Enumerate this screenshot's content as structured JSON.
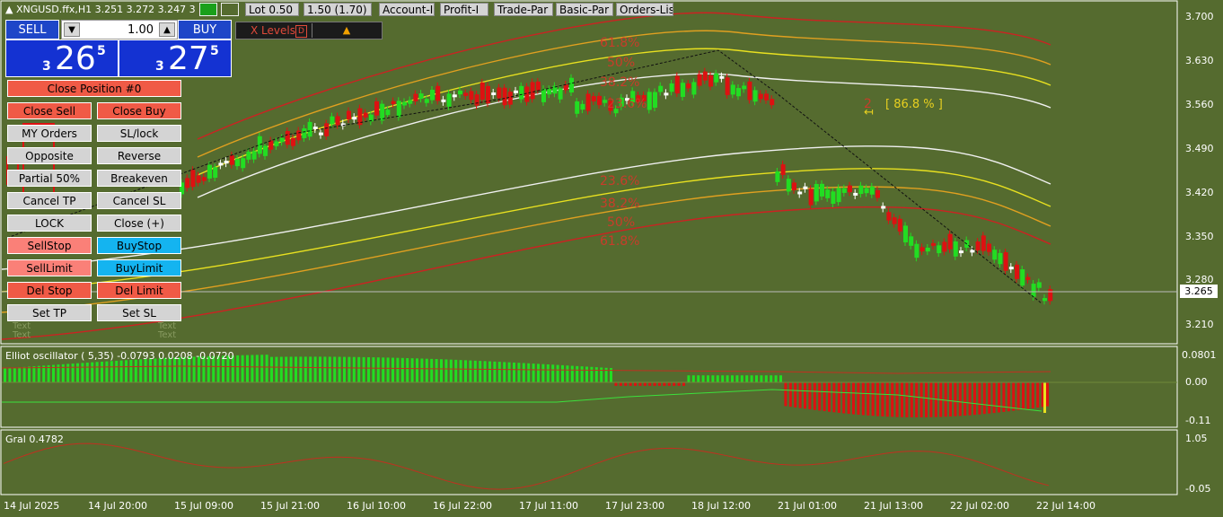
{
  "header": {
    "symbol_info": "XNGUSD.ffx,H1  3.251 3.272 3.247 3",
    "buttons": [
      "Lot 0.50",
      "1.50 (1.70)",
      "Account-I",
      "Profit-I",
      "Trade-Par",
      "Basic-Par",
      "Orders-List"
    ]
  },
  "trade_panel": {
    "sell_label": "SELL",
    "buy_label": "BUY",
    "lot_value": "1.00",
    "sell_price": {
      "prefix": "3",
      "big": "26",
      "sup": "5"
    },
    "buy_price": {
      "prefix": "3",
      "big": "27",
      "sup": "5"
    }
  },
  "xlevels": {
    "label": "X Levels",
    "box": "D"
  },
  "actions": {
    "close_position": "Close Position #0",
    "rows": [
      [
        "Close Sell",
        "Close Buy"
      ],
      [
        "MY Orders",
        "SL/lock"
      ],
      [
        "Opposite",
        "Reverse"
      ],
      [
        "Partial 50%",
        "Breakeven"
      ],
      [
        "Cancel TP",
        "Cancel SL"
      ],
      [
        "LOCK",
        "Close (+)"
      ],
      [
        "SellStop",
        "BuyStop"
      ],
      [
        "SellLimit",
        "BuyLimit"
      ],
      [
        "Del Stop",
        "Del Limit"
      ],
      [
        "Set TP",
        "Set SL"
      ]
    ],
    "text_placeholder": "Text"
  },
  "fib_labels": {
    "upper": [
      "61.8%",
      "50%",
      "38.2%",
      "23.6%"
    ],
    "lower": [
      "23.6%",
      "38.2%",
      "50%",
      "61.8%"
    ]
  },
  "annotation": {
    "wave": "2",
    "pct": "[ 86.8 % ]"
  },
  "price_axis": {
    "labels": [
      "3.700",
      "3.630",
      "3.560",
      "3.490",
      "3.420",
      "3.350",
      "3.280",
      "3.210"
    ],
    "current": "3.265"
  },
  "osc": {
    "title": "Elliot oscillator ( 5,35) -0.0793 0.0208 -0.0720",
    "labels": [
      "0.0801",
      "0.00",
      "-0.11"
    ]
  },
  "gral": {
    "title": "Gral 0.4782",
    "labels": [
      "1.05",
      "-0.05"
    ]
  },
  "time_axis": [
    "14 Jul 2025",
    "14 Jul 20:00",
    "15 Jul 09:00",
    "15 Jul 21:00",
    "16 Jul 10:00",
    "16 Jul 22:00",
    "17 Jul 11:00",
    "17 Jul 23:00",
    "18 Jul 12:00",
    "21 Jul 01:00",
    "21 Jul 13:00",
    "22 Jul 02:00",
    "22 Jul 14:00"
  ],
  "colors": {
    "background": "#556b2f",
    "bull": "#22dd22",
    "bear": "#dd1111",
    "doji": "#ffffff",
    "band_red": "#cc2222",
    "band_orange": "#e0a020",
    "band_yellow": "#e8e020",
    "band_white": "#f0f0f0"
  }
}
